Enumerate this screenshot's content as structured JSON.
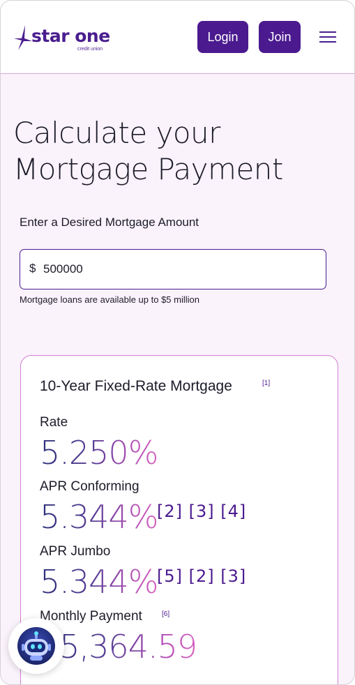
{
  "header": {
    "logo_text": "star one",
    "logo_sub": "credit union",
    "login_label": "Login",
    "join_label": "Join",
    "menu_icon": "hamburger-menu-icon"
  },
  "main": {
    "title_line1": "Calculate your",
    "title_line2": "Mortgage Payment",
    "amount_label": "Enter a Desired Mortgage Amount",
    "currency_symbol": "$",
    "amount_value": "500000",
    "amount_help": "Mortgage loans are available up to $5 million"
  },
  "card": {
    "title": "10-Year Fixed-Rate Mortgage",
    "title_ref": "[1]",
    "rate_label": "Rate",
    "rate_value": "5.250%",
    "apr_conforming_label": "APR Conforming",
    "apr_conforming_value": "5.344%",
    "apr_conforming_refs": "[2] [3] [4]",
    "apr_jumbo_label": "APR Jumbo",
    "apr_jumbo_value": "5.344%",
    "apr_jumbo_refs": "[5] [2] [3]",
    "monthly_payment_label": "Monthly Payment",
    "monthly_payment_ref": "[6]",
    "monthly_payment_value": "$5,364.59"
  },
  "chat": {
    "icon": "chat-bot-icon"
  },
  "colors": {
    "brand": "#4b1a8f",
    "card_border": "#d27fd2",
    "background": "#fbf3fb",
    "gradient_start": "#2c2f7a",
    "gradient_end": "#d760be"
  }
}
